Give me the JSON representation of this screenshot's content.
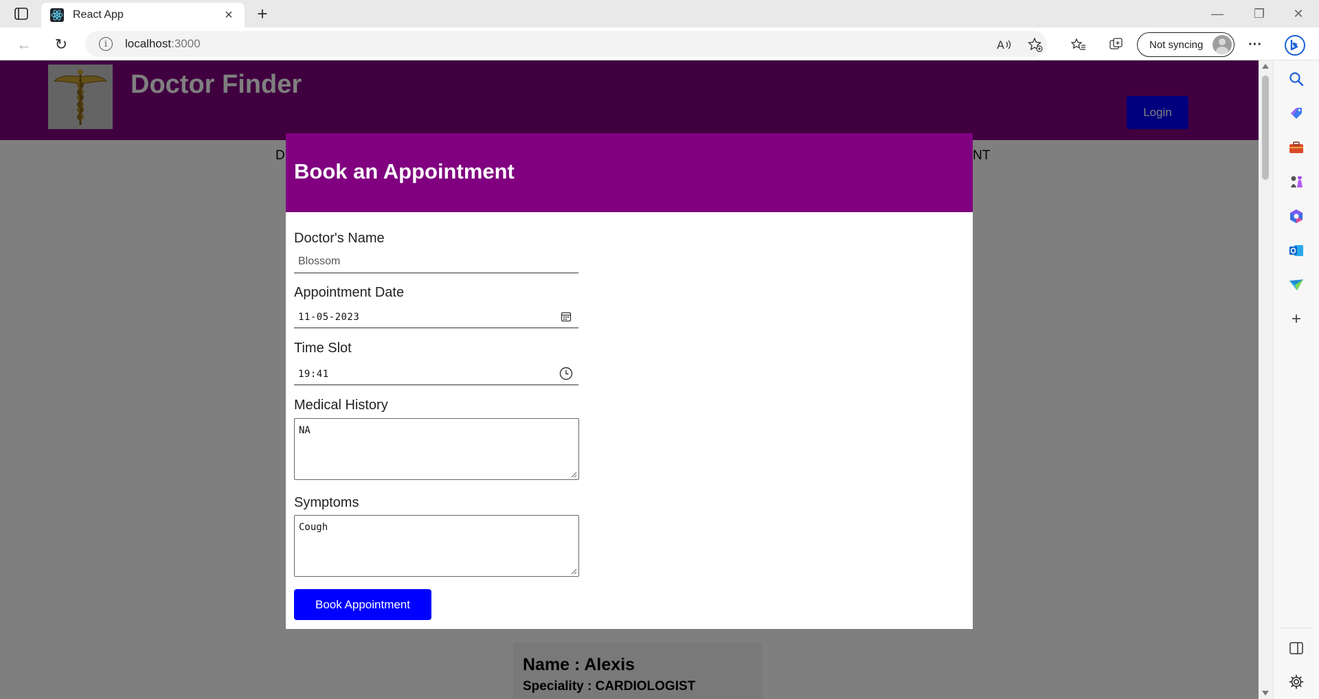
{
  "browser": {
    "tab_title": "React App",
    "tab_close": "×",
    "new_tab": "+",
    "url_host": "localhost",
    "url_port": ":3000",
    "sync_label": "Not syncing",
    "window_controls": {
      "minimize": "—",
      "restore": "❐",
      "close": "✕"
    },
    "nav": {
      "back": "←",
      "reload": "↻"
    },
    "more": "···"
  },
  "site": {
    "title": "Doctor Finder",
    "login_label": "Login",
    "nav_left_fragment": "D",
    "nav_right_fragment": "NT"
  },
  "modal": {
    "title": "Book an Appointment",
    "fields": {
      "doctor_name": {
        "label": "Doctor's Name",
        "value": "Blossom"
      },
      "appointment_date": {
        "label": "Appointment Date",
        "value": "11-05-2023"
      },
      "time_slot": {
        "label": "Time Slot",
        "value": "19:41"
      },
      "medical_history": {
        "label": "Medical History",
        "value": "NA"
      },
      "symptoms": {
        "label": "Symptoms",
        "value": "Cough"
      }
    },
    "submit_label": "Book Appointment"
  },
  "doctor_card": {
    "name": "Name : Alexis",
    "speciality": "Speciality : CARDIOLOGIST"
  },
  "colors": {
    "header_bg": "#800080",
    "modal_header_bg": "#800080",
    "primary_button": "#0000ff",
    "overlay": "rgba(0,0,0,0.5)"
  },
  "icons": {
    "tab_sidebar": "tab-sidebar-icon",
    "favicon": "react-logo-icon",
    "info": "info-icon",
    "read_aloud": "read-aloud-icon",
    "add_favorite": "add-favorite-icon",
    "favorites": "favorites-icon",
    "collections": "collections-icon",
    "bing": "bing-icon",
    "calendar": "calendar-icon",
    "clock": "clock-icon",
    "logo": "caduceus-logo-icon"
  }
}
